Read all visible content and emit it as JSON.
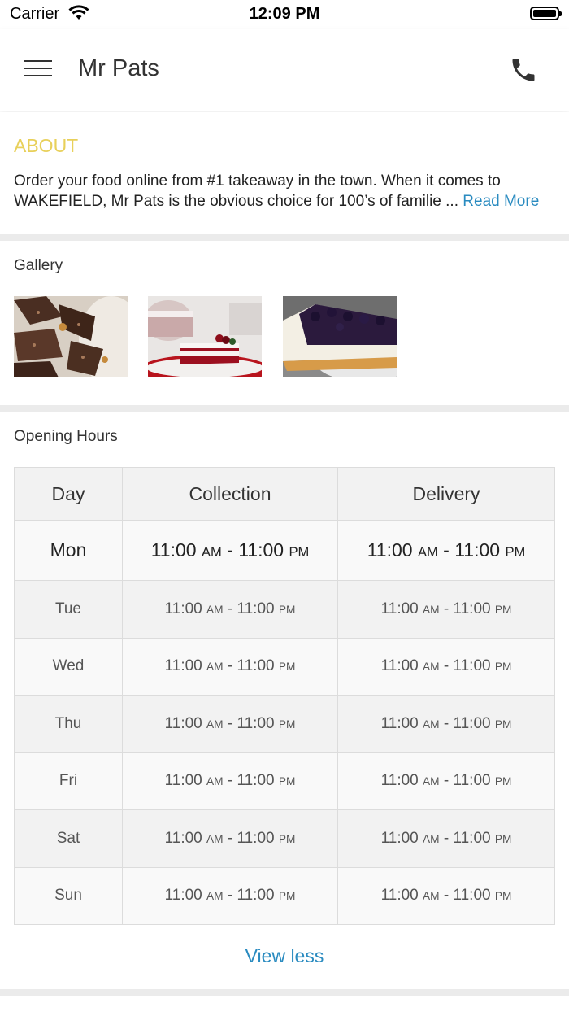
{
  "status_bar": {
    "carrier": "Carrier",
    "time": "12:09 PM"
  },
  "header": {
    "title": "Mr Pats",
    "menu_icon": "hamburger-menu-icon",
    "phone_icon": "phone-icon"
  },
  "about": {
    "heading": "ABOUT",
    "text": "Order your food online from #1 takeaway in the town. When it comes to WAKEFIELD, Mr Pats is the obvious choice for 100’s of familie ...",
    "read_more": "Read More"
  },
  "gallery": {
    "title": "Gallery",
    "images": [
      "chocolate-brownie-slices",
      "red-velvet-cake-slice",
      "blueberry-cheesecake-slice"
    ]
  },
  "opening_hours": {
    "title": "Opening Hours",
    "headers": {
      "day": "Day",
      "collection": "Collection",
      "delivery": "Delivery"
    },
    "rows": [
      {
        "day": "Mon",
        "collection": {
          "open": "11:00",
          "open_suffix": "AM",
          "close": "11:00",
          "close_suffix": "PM"
        },
        "delivery": {
          "open": "11:00",
          "open_suffix": "AM",
          "close": "11:00",
          "close_suffix": "PM"
        }
      },
      {
        "day": "Tue",
        "collection": {
          "open": "11:00",
          "open_suffix": "AM",
          "close": "11:00",
          "close_suffix": "PM"
        },
        "delivery": {
          "open": "11:00",
          "open_suffix": "AM",
          "close": "11:00",
          "close_suffix": "PM"
        }
      },
      {
        "day": "Wed",
        "collection": {
          "open": "11:00",
          "open_suffix": "AM",
          "close": "11:00",
          "close_suffix": "PM"
        },
        "delivery": {
          "open": "11:00",
          "open_suffix": "AM",
          "close": "11:00",
          "close_suffix": "PM"
        }
      },
      {
        "day": "Thu",
        "collection": {
          "open": "11:00",
          "open_suffix": "AM",
          "close": "11:00",
          "close_suffix": "PM"
        },
        "delivery": {
          "open": "11:00",
          "open_suffix": "AM",
          "close": "11:00",
          "close_suffix": "PM"
        }
      },
      {
        "day": "Fri",
        "collection": {
          "open": "11:00",
          "open_suffix": "AM",
          "close": "11:00",
          "close_suffix": "PM"
        },
        "delivery": {
          "open": "11:00",
          "open_suffix": "AM",
          "close": "11:00",
          "close_suffix": "PM"
        }
      },
      {
        "day": "Sat",
        "collection": {
          "open": "11:00",
          "open_suffix": "AM",
          "close": "11:00",
          "close_suffix": "PM"
        },
        "delivery": {
          "open": "11:00",
          "open_suffix": "AM",
          "close": "11:00",
          "close_suffix": "PM"
        }
      },
      {
        "day": "Sun",
        "collection": {
          "open": "11:00",
          "open_suffix": "AM",
          "close": "11:00",
          "close_suffix": "PM"
        },
        "delivery": {
          "open": "11:00",
          "open_suffix": "AM",
          "close": "11:00",
          "close_suffix": "PM"
        }
      }
    ],
    "view_less": "View less"
  },
  "colors": {
    "accent": "#e8d05a",
    "link": "#2a8bc0",
    "divider": "#ebebeb"
  }
}
